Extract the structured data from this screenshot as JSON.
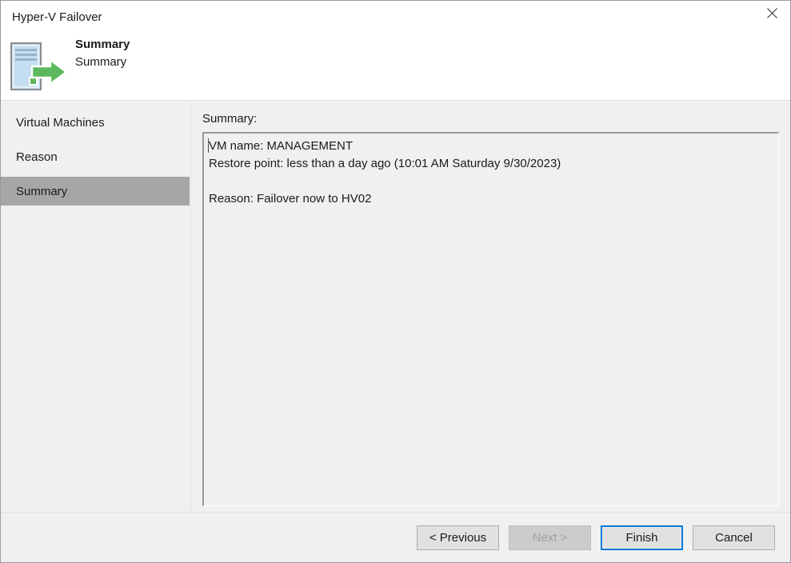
{
  "window": {
    "title": "Hyper-V Failover",
    "close_icon": "close-icon"
  },
  "header": {
    "icon": "server-failover-icon",
    "title": "Summary",
    "subtitle": "Summary"
  },
  "sidebar": {
    "items": [
      {
        "label": "Virtual Machines",
        "selected": false
      },
      {
        "label": "Reason",
        "selected": false
      },
      {
        "label": "Summary",
        "selected": true
      }
    ]
  },
  "content": {
    "label": "Summary:",
    "summary_text": "VM name: MANAGEMENT\nRestore point: less than a day ago (10:01 AM Saturday 9/30/2023)\n\nReason: Failover now to HV02"
  },
  "footer": {
    "previous_label": "< Previous",
    "next_label": "Next >",
    "finish_label": "Finish",
    "cancel_label": "Cancel"
  },
  "colors": {
    "accent": "#0078d7",
    "selected_nav": "#a6a6a6",
    "panel": "#f0f0f0",
    "icon_green": "#5cb85c",
    "icon_blue": "#c5ddf2"
  }
}
